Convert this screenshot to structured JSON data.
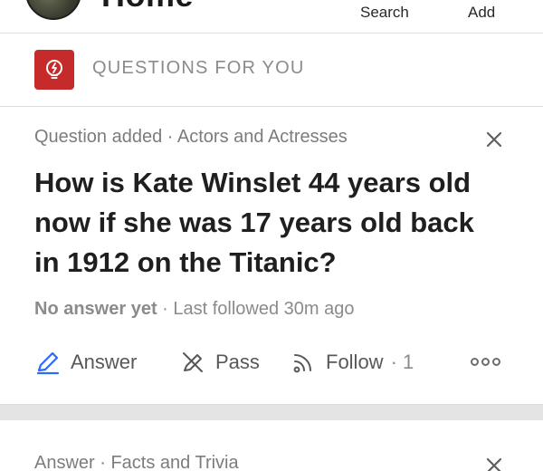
{
  "header": {
    "title": "Home",
    "nav": {
      "search_label": "Search",
      "add_label": "Add"
    }
  },
  "section": {
    "title": "QUESTIONS FOR YOU",
    "icon": "lightbulb-icon",
    "icon_bg": "#c52b2b"
  },
  "card": {
    "meta": "Question added · Actors and Actresses",
    "question": "How is Kate Winslet 44 years old now if she was 17 years old back in 1912 on the Titanic?",
    "status_strong": "No answer yet",
    "status_rest": " · Last followed 30m ago",
    "actions": {
      "answer_label": "Answer",
      "pass_label": "Pass",
      "follow_label": "Follow",
      "follow_count": "· 1"
    },
    "accent": "#2e69ff"
  },
  "next_card": {
    "meta": "Answer · Facts and Trivia"
  }
}
